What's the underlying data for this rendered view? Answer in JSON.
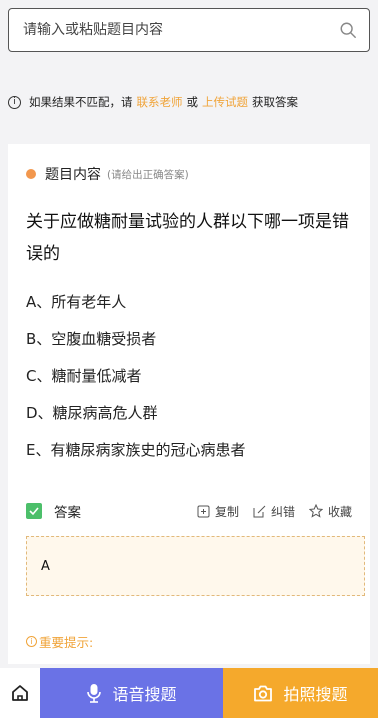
{
  "search": {
    "placeholder": "请输入或粘贴题目内容"
  },
  "notice": {
    "prefix": "如果结果不匹配，请",
    "link_teacher": "联系老师",
    "or": "或",
    "link_upload": "上传试题",
    "suffix": "获取答案"
  },
  "question_section": {
    "title": "题目内容",
    "note": "(请给出正确答案)"
  },
  "question": {
    "text": "关于应做糖耐量试验的人群以下哪一项是错误的",
    "options": [
      "A、所有老年人",
      "B、空腹血糖受损者",
      "C、糖耐量低减者",
      "D、糖尿病高危人群",
      "E、有糖尿病家族史的冠心病患者"
    ]
  },
  "answer": {
    "label": "答案",
    "copy": "复制",
    "correct": "纠错",
    "favorite": "收藏",
    "value": "A"
  },
  "tip": {
    "title": "重要提示:"
  },
  "bottom": {
    "voice": "语音搜题",
    "photo": "拍照搜题"
  },
  "colors": {
    "accent_orange": "#f0a43a",
    "voice_bg": "#6a72e6",
    "photo_bg": "#f5a92c",
    "dot": "#f2974d",
    "answer_icon": "#4cbf6a"
  }
}
